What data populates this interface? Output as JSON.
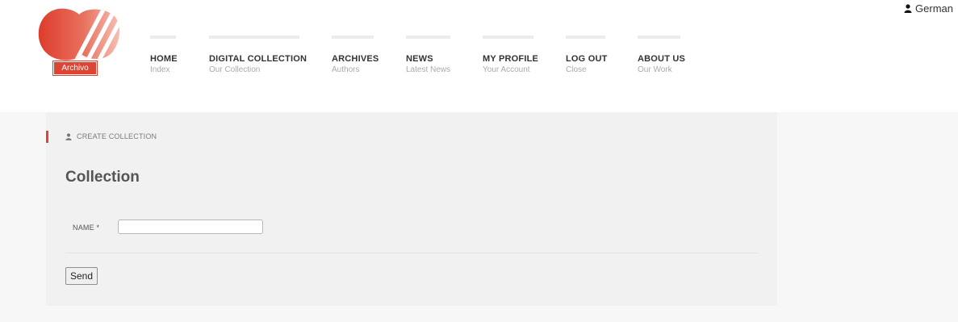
{
  "header": {
    "language_label": "German",
    "logo_text": "Archivo",
    "brand_color": "#dd4433"
  },
  "nav": [
    {
      "title": "HOME",
      "sub": "Index"
    },
    {
      "title": "DIGITAL COLLECTION",
      "sub": "Our Collection"
    },
    {
      "title": "ARCHIVES",
      "sub": "Authors"
    },
    {
      "title": "NEWS",
      "sub": "Latest News"
    },
    {
      "title": "MY PROFILE",
      "sub": "Your Account"
    },
    {
      "title": "LOG OUT",
      "sub": "Close"
    },
    {
      "title": "ABOUT US",
      "sub": "Our Work"
    }
  ],
  "main": {
    "breadcrumb": "CREATE COLLECTION",
    "title": "Collection",
    "form": {
      "name_label": "NAME *",
      "name_value": "",
      "send_label": "Send"
    }
  },
  "icons": {
    "language": "user-icon",
    "breadcrumb": "user-icon"
  }
}
